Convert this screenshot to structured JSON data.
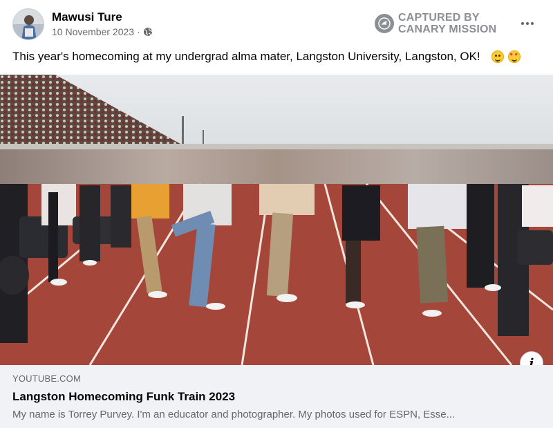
{
  "post": {
    "author": "Mawusi Ture",
    "date": "10 November 2023",
    "separator": "·",
    "audience_icon": "globe-icon",
    "caption": "This year's homecoming at my undergrad alma mater, Langston University, Langston, OK!",
    "emojis": [
      "smiling-face-emoji",
      "heart-eyes-emoji"
    ]
  },
  "watermark": {
    "line1": "CAPTURED BY",
    "line2": "CANARY MISSION",
    "icon": "canary-mission-logo"
  },
  "media": {
    "description_icon": "info-icon",
    "info_glyph": "i"
  },
  "link_preview": {
    "domain": "YOUTUBE.COM",
    "title": "Langston Homecoming Funk Train 2023",
    "description": "My name is Torrey Purvey. I'm an educator and photographer. My photos used for ESPN, Esse..."
  },
  "colors": {
    "track": "#a4473a",
    "track_lines": "#f3e6df",
    "sky": "#e6e9ec",
    "link_box_bg": "#f0f2f5",
    "secondary_text": "#65676b",
    "watermark": "#8c8f93"
  }
}
